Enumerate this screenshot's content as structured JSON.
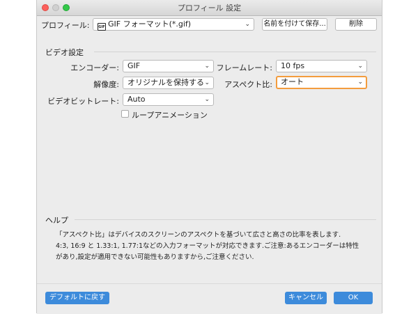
{
  "window": {
    "title": "プロフィール 設定"
  },
  "toolbar": {
    "profile_label": "プロフィール:",
    "profile_icon_text": "GIF",
    "profile_value": "GIF フォーマット(*.gif)",
    "save_as_label": "名前を付けて保存...",
    "delete_label": "削除"
  },
  "video_settings": {
    "title": "ビデオ設定",
    "encoder_label": "エンコーダー:",
    "encoder_value": "GIF",
    "frame_rate_label": "フレームレート:",
    "frame_rate_value": "10 fps",
    "resolution_label": "解像度:",
    "resolution_value": "オリジナルを保持する",
    "aspect_label": "アスペクト比:",
    "aspect_value": "オート",
    "bitrate_label": "ビデオビットレート:",
    "bitrate_value": "Auto",
    "loop_label": "ループアニメーション",
    "loop_checked": false
  },
  "help": {
    "title": "ヘルプ",
    "lines": [
      "「アスペクト比」はデバイスのスクリーンのアスペクトを基づいて広さと高さの比率を表します.",
      "4:3, 16:9 と 1.33:1, 1.77:1などの入力フォーマットが対応できます.ご注意:あるエンコーダーは特性",
      "があり,設定が適用できない可能性もありますから,ご注意ください."
    ]
  },
  "footer": {
    "default_label": "デフォルトに戻す",
    "cancel_label": "キャンセル",
    "ok_label": "OK"
  },
  "colors": {
    "accent_blue": "#3d8bdb",
    "focus_orange": "#f39c3d",
    "close_red": "#fc605c",
    "zoom_green": "#34c84a"
  },
  "icons": {
    "dropdown": "chevron-down-icon",
    "profile": "gif-file-icon"
  }
}
